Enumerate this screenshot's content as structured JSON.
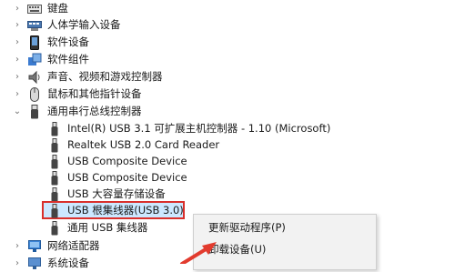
{
  "tree": {
    "categories": [
      {
        "label": "键盘",
        "icon": "keyboard-icon",
        "expanded": false
      },
      {
        "label": "人体学输入设备",
        "icon": "hid-icon",
        "expanded": false
      },
      {
        "label": "软件设备",
        "icon": "software-device-icon",
        "expanded": false
      },
      {
        "label": "软件组件",
        "icon": "software-component-icon",
        "expanded": false
      },
      {
        "label": "声音、视频和游戏控制器",
        "icon": "speaker-icon",
        "expanded": false
      },
      {
        "label": "鼠标和其他指针设备",
        "icon": "mouse-icon",
        "expanded": false
      },
      {
        "label": "通用串行总线控制器",
        "icon": "usb-icon",
        "expanded": true
      }
    ],
    "usb_children": [
      {
        "label": "Intel(R) USB 3.1 可扩展主机控制器 - 1.10 (Microsoft)"
      },
      {
        "label": "Realtek USB 2.0 Card Reader"
      },
      {
        "label": "USB Composite Device"
      },
      {
        "label": "USB Composite Device"
      },
      {
        "label": "USB 大容量存储设备"
      },
      {
        "label": "USB 根集线器(USB 3.0)",
        "selected": true
      },
      {
        "label": "通用 USB 集线器"
      }
    ],
    "after": [
      {
        "label": "网络适配器",
        "icon": "network-adapter-icon"
      },
      {
        "label": "系统设备",
        "icon": "system-device-icon"
      }
    ]
  },
  "context_menu": {
    "items": [
      "更新驱动程序(P)",
      "卸载设备(U)"
    ]
  },
  "colors": {
    "highlight_border": "#d9302c",
    "selection_fill": "#cce8ff",
    "annotation_arrow": "#e23b2e"
  }
}
